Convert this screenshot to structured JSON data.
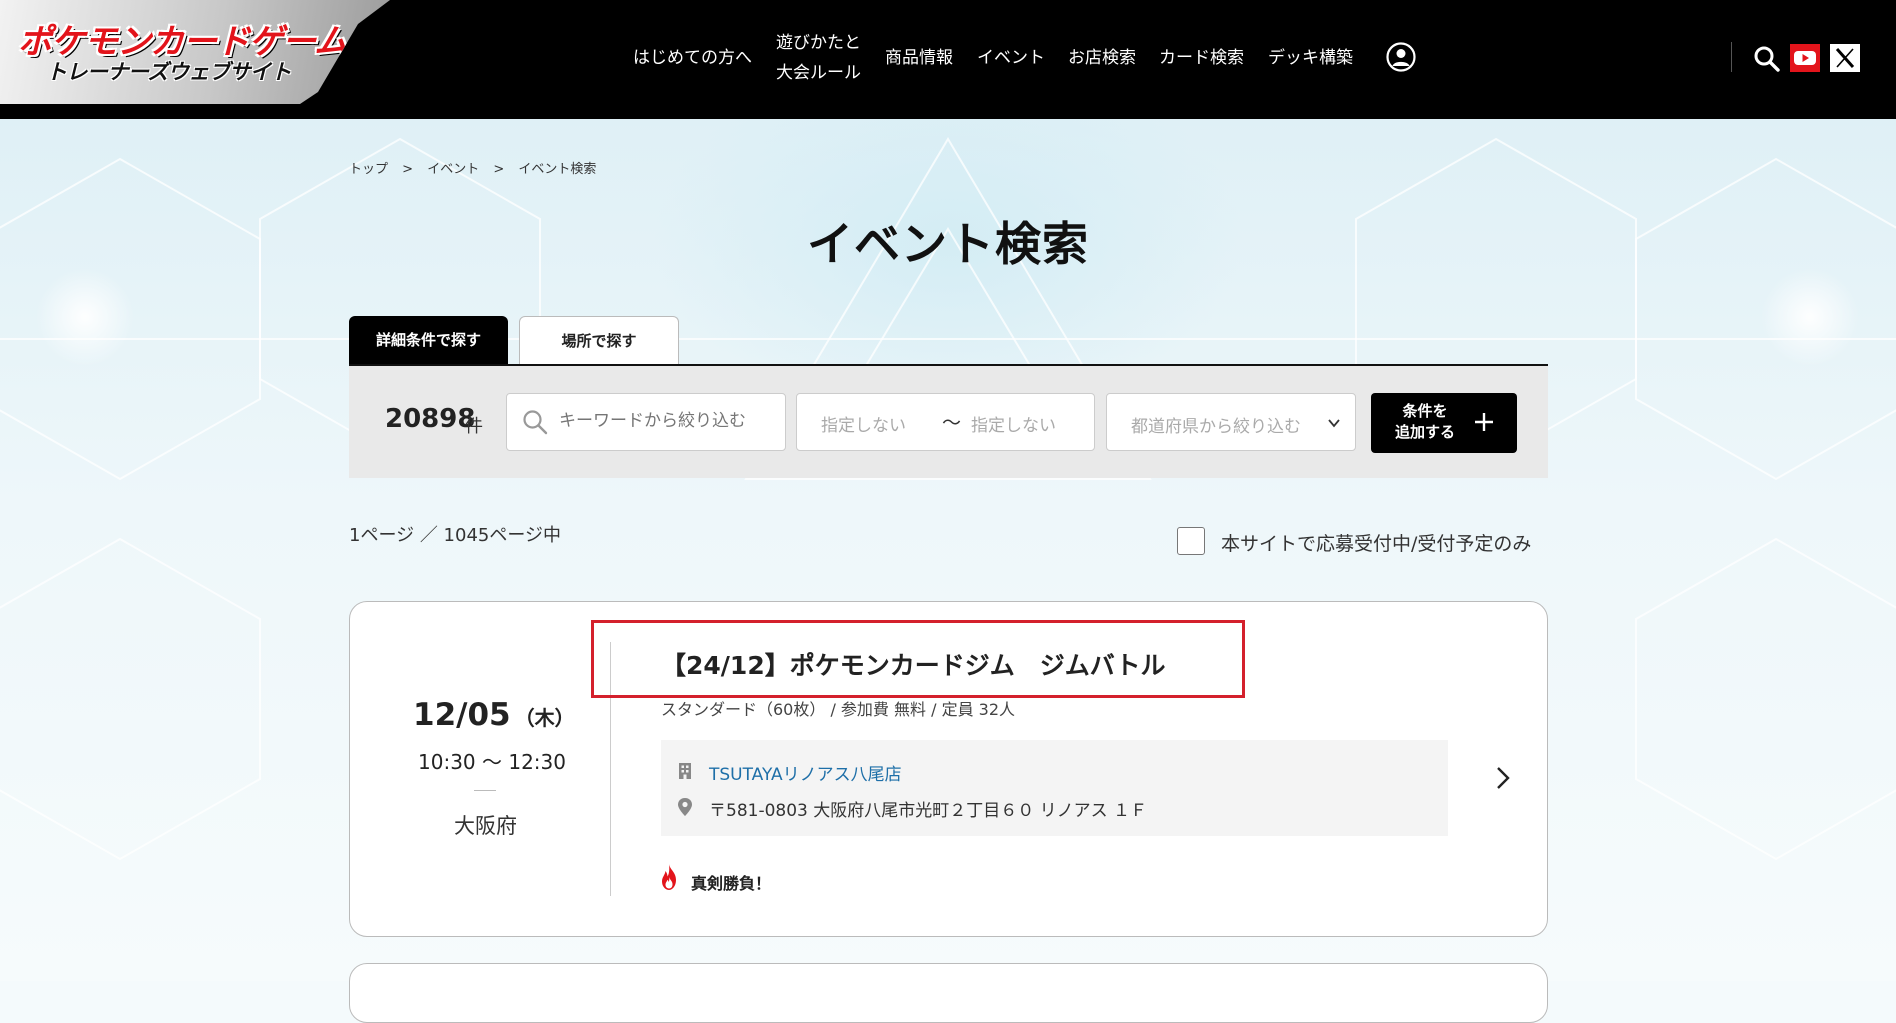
{
  "header": {
    "logo_title": "ポケモンカードゲーム",
    "logo_subtitle": "トレーナーズウェブサイト",
    "nav": [
      {
        "label": "はじめての方へ"
      },
      {
        "label_line1": "遊びかたと",
        "label_line2": "大会ルール"
      },
      {
        "label": "商品情報"
      },
      {
        "label": "イベント"
      },
      {
        "label": "お店検索"
      },
      {
        "label": "カード検索"
      },
      {
        "label": "デッキ構築"
      }
    ],
    "icons": {
      "user": "user-icon",
      "search": "search-icon",
      "youtube": "youtube-icon",
      "x": "x-icon"
    },
    "colors": {
      "bar": "#000000",
      "youtube": "#e3141b"
    }
  },
  "breadcrumb": [
    "トップ",
    ">",
    "イベント",
    ">",
    "イベント検索"
  ],
  "page_title": "イベント検索",
  "tabs": {
    "active": "詳細条件で探す",
    "inactive": "場所で探す"
  },
  "filter": {
    "count": "20898",
    "count_unit": "件",
    "keyword_placeholder": "キーワードから絞り込む",
    "date_from": "指定しない",
    "date_sep": "〜",
    "date_to": "指定しない",
    "prefecture_placeholder": "都道府県から絞り込む",
    "add_line1": "条件を",
    "add_line2": "追加する"
  },
  "paging": "1ページ ／ 1045ページ中",
  "only_open_label": "本サイトで応募受付中/受付予定のみ",
  "event": {
    "date": "12/05",
    "dow": "（木）",
    "time": "10:30 〜 12:30",
    "prefecture": "大阪府",
    "title": "【24/12】ポケモンカードジム　ジムバトル",
    "subtitle": "スタンダード（60枚） / 参加費 無料 / 定員 32人",
    "shop_name": "TSUTAYAリノアス八尾店",
    "shop_address": "〒581-0803 大阪府八尾市光町２丁目６０ リノアス １Ｆ",
    "tag": "真剣勝負！",
    "highlight_color": "#d4202c"
  }
}
